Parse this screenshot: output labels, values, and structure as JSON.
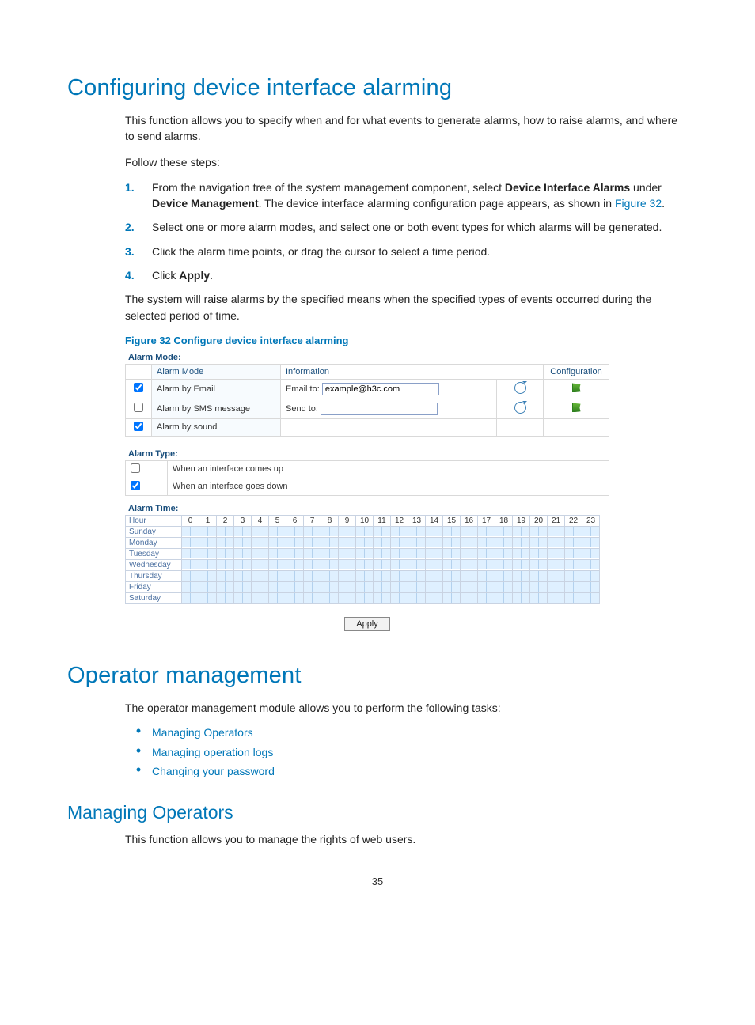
{
  "h1_1": "Configuring device interface alarming",
  "p_intro1": "This function allows you to specify when and for what events to generate alarms, how to raise alarms, and where to send alarms.",
  "p_follow": "Follow these steps:",
  "steps": [
    {
      "n": "1.",
      "pre": "From the navigation tree of the system management component, select ",
      "b1": "Device Interface Alarms",
      "mid": " under ",
      "b2": "Device Management",
      "post": ". The device interface alarming configuration page appears, as shown in ",
      "link": "Figure 32",
      "end": "."
    },
    {
      "n": "2.",
      "txt": "Select one or more alarm modes, and select one or both event types for which alarms will be generated."
    },
    {
      "n": "3.",
      "txt": "Click the alarm time points, or drag the cursor to select a time period."
    },
    {
      "n": "4.",
      "pre": "Click ",
      "b1": "Apply",
      "post": "."
    }
  ],
  "p_after": "The system will raise alarms by the specified means when the specified types of events occurred during the selected period of time.",
  "figcap": "Figure 32 Configure device interface alarming",
  "fig": {
    "mode_label": "Alarm Mode:",
    "th_mode": "Alarm Mode",
    "th_info": "Information",
    "th_cfg": "Configuration",
    "rows": [
      {
        "checked": true,
        "mode": "Alarm by Email",
        "info_label": "Email to:",
        "info_val": "example@h3c.com",
        "has_refresh": true,
        "has_cfg": true
      },
      {
        "checked": false,
        "mode": "Alarm by SMS message",
        "info_label": "Send to:",
        "info_val": "",
        "has_refresh": true,
        "has_cfg": true
      },
      {
        "checked": true,
        "mode": "Alarm by sound",
        "info_label": "",
        "info_val": "",
        "has_refresh": false,
        "has_cfg": false
      }
    ],
    "type_label": "Alarm Type:",
    "types": [
      {
        "checked": false,
        "txt": "When an interface comes up"
      },
      {
        "checked": true,
        "txt": "When an interface goes down"
      }
    ],
    "time_label": "Alarm Time:",
    "hour_h": "Hour",
    "hours": [
      "0",
      "1",
      "2",
      "3",
      "4",
      "5",
      "6",
      "7",
      "8",
      "9",
      "10",
      "11",
      "12",
      "13",
      "14",
      "15",
      "16",
      "17",
      "18",
      "19",
      "20",
      "21",
      "22",
      "23"
    ],
    "days": [
      "Sunday",
      "Monday",
      "Tuesday",
      "Wednesday",
      "Thursday",
      "Friday",
      "Saturday"
    ],
    "apply": "Apply"
  },
  "h1_2": "Operator management",
  "p_op": "The operator management module allows you to perform the following tasks:",
  "bullets": [
    "Managing Operators",
    "Managing operation logs",
    "Changing your password"
  ],
  "h2_1": "Managing Operators",
  "p_mg": "This function allows you to manage the rights of web users.",
  "pagenum": "35"
}
